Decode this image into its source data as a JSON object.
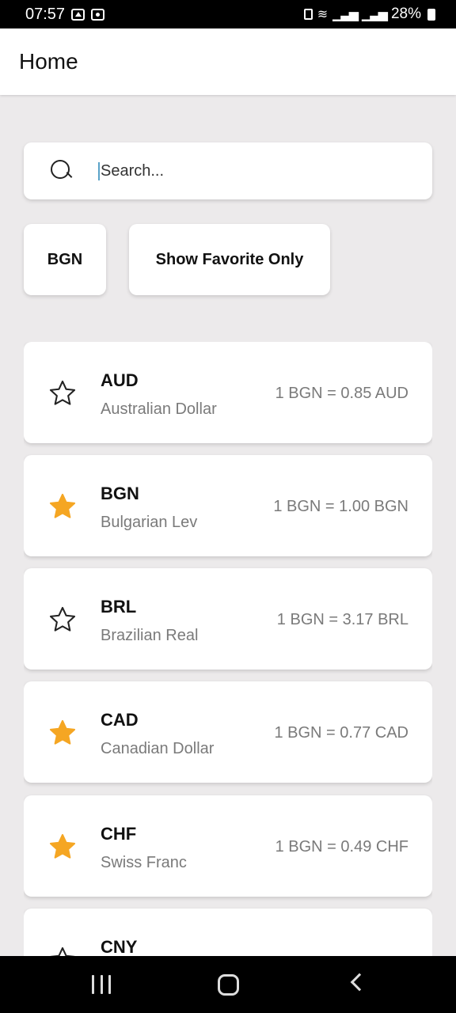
{
  "status_bar": {
    "time": "07:57",
    "battery": "28%",
    "icons": [
      "image-icon",
      "camera-icon",
      "lock-icon",
      "wifi-icon",
      "signal-icon",
      "signal-icon",
      "battery-icon"
    ]
  },
  "app_bar": {
    "title": "Home"
  },
  "search": {
    "placeholder": "Search...",
    "value": ""
  },
  "filters": {
    "base_currency": "BGN",
    "favorite_label": "Show Favorite Only"
  },
  "colors": {
    "star_active": "#f5a623",
    "star_inactive": "#222222",
    "secondary_text": "#7a7a7a",
    "background": "#eceaeb"
  },
  "currencies": [
    {
      "code": "AUD",
      "name": "Australian Dollar",
      "rate": "1 BGN = 0.85 AUD",
      "favorite": false
    },
    {
      "code": "BGN",
      "name": "Bulgarian Lev",
      "rate": "1 BGN = 1.00 BGN",
      "favorite": true
    },
    {
      "code": "BRL",
      "name": "Brazilian Real",
      "rate": "1 BGN = 3.17 BRL",
      "favorite": false
    },
    {
      "code": "CAD",
      "name": "Canadian Dollar",
      "rate": "1 BGN = 0.77 CAD",
      "favorite": true
    },
    {
      "code": "CHF",
      "name": "Swiss Franc",
      "rate": "1 BGN = 0.49 CHF",
      "favorite": true
    },
    {
      "code": "CNY",
      "name": "",
      "rate": "",
      "favorite": false
    }
  ],
  "nav_bar": {
    "icons": [
      "recents-icon",
      "home-icon",
      "back-icon"
    ]
  }
}
